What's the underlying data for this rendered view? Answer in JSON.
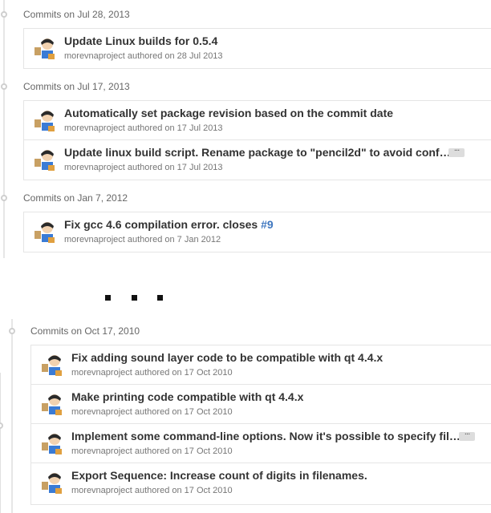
{
  "groups": [
    {
      "header": "Commits on Jul 28, 2013",
      "commits": [
        {
          "title": "Update Linux builds for 0.5.4",
          "author": "morevnaproject",
          "authored": "authored on 28 Jul 2013"
        }
      ]
    },
    {
      "header": "Commits on Jul 17, 2013",
      "commits": [
        {
          "title": "Automatically set package revision based on the commit date",
          "author": "morevnaproject",
          "authored": "authored on 17 Jul 2013"
        },
        {
          "title": "Update linux build script. Rename package to \"pencil2d\" to avoid conf…",
          "author": "morevnaproject",
          "authored": "authored on 17 Jul 2013",
          "ellipsis": "···"
        }
      ]
    },
    {
      "header": "Commits on Jan 7, 2012",
      "commits": [
        {
          "title": "Fix gcc 4.6 compilation error. closes ",
          "issue": "#9",
          "author": "morevnaproject",
          "authored": "authored on 7 Jan 2012"
        }
      ]
    },
    {
      "header": "Commits on Oct 17, 2010",
      "commits": [
        {
          "title": "Fix adding sound layer code to be compatible with qt 4.4.x",
          "author": "morevnaproject",
          "authored": "authored on 17 Oct 2010"
        },
        {
          "title": "Make printing code compatible with qt 4.4.x",
          "author": "morevnaproject",
          "authored": "authored on 17 Oct 2010"
        },
        {
          "title": "Implement some command-line options. Now it's possible to specify fil…",
          "author": "morevnaproject",
          "authored": "authored on 17 Oct 2010",
          "ellipsis": "···"
        },
        {
          "title": "Export Sequence: Increase count of digits in filenames.",
          "author": "morevnaproject",
          "authored": "authored on 17 Oct 2010"
        }
      ]
    }
  ],
  "colors": {
    "issue_link": "#4078c0",
    "text": "#333333",
    "meta": "#767676"
  },
  "icons": {
    "avatar": "avatar-icon",
    "timeline": "timeline-dot-icon"
  }
}
